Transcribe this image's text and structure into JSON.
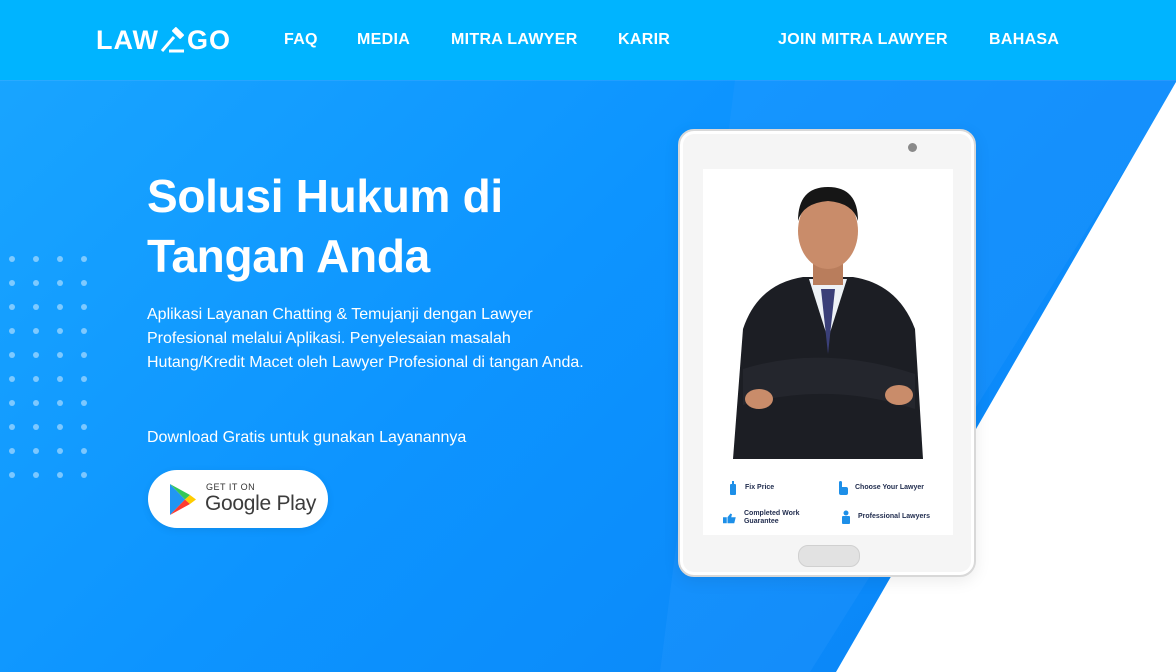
{
  "nav": {
    "logo_left": "LAW",
    "logo_right": "GO",
    "links": [
      "FAQ",
      "MEDIA",
      "MITRA LAWYER",
      "KARIR"
    ],
    "right_links": [
      "JOIN MITRA LAWYER",
      "BAHASA"
    ]
  },
  "hero": {
    "title_line1": "Solusi Hukum di",
    "title_line2": "Tangan Anda",
    "description": "Aplikasi Layanan Chatting & Temujanji dengan Lawyer Profesional melalui Aplikasi. Penyelesaian masalah Hutang/Kredit Macet oleh Lawyer Profesional di tangan Anda.",
    "cta_text": "Download Gratis untuk gunakan Layanannya",
    "google_play": {
      "small": "GET IT ON",
      "big": "Google Play"
    }
  },
  "tablet": {
    "features": [
      "Fix Price",
      "Choose Your Lawyer",
      "Completed Work Guarantee",
      "Professional Lawyers"
    ]
  },
  "colors": {
    "navbar": "#00b4ff",
    "hero": "#0d94ff",
    "accent": "#1aa6ff",
    "white": "#ffffff"
  },
  "icons": [
    "gavel-icon",
    "google-play-icon",
    "price-tag-icon",
    "finger-pointer-icon",
    "thumbs-up-icon",
    "lawyer-person-icon"
  ]
}
